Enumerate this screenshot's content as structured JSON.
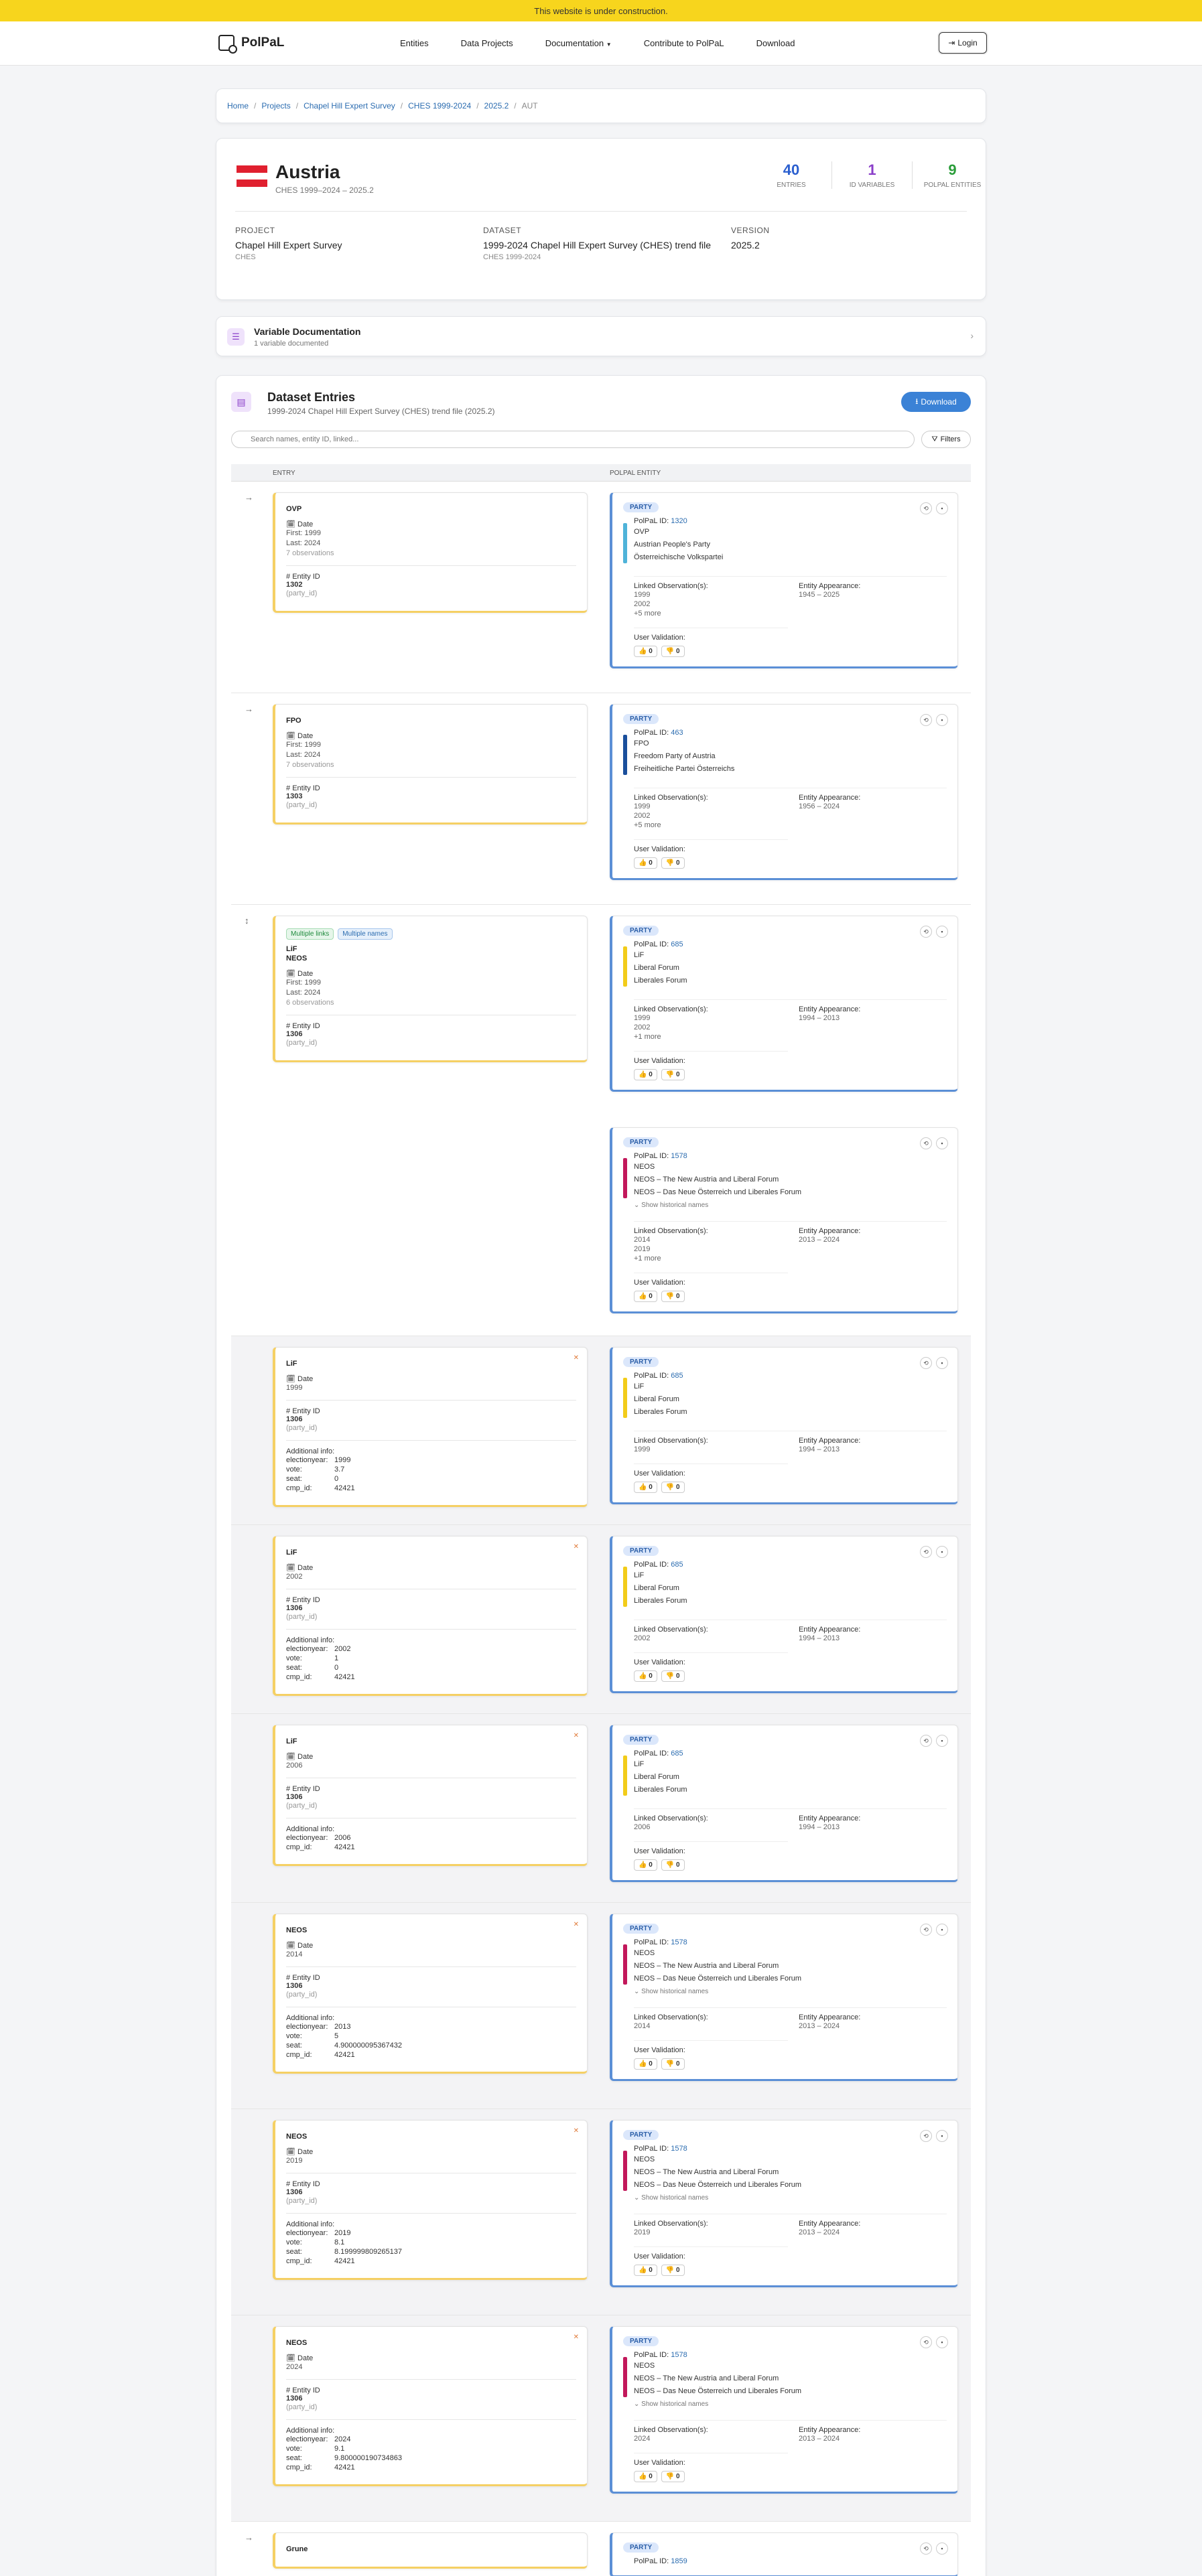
{
  "banner": "This website is under construction.",
  "nav": {
    "brand": "PolPaL",
    "items": [
      "Entities",
      "Data Projects",
      "Documentation",
      "Contribute to PolPaL",
      "Download"
    ],
    "login": "Login"
  },
  "breadcrumb": [
    "Home",
    "Projects",
    "Chapel Hill Expert Survey",
    "CHES 1999-2024",
    "2025.2",
    "AUT"
  ],
  "country": {
    "name": "Austria",
    "range": "CHES 1999–2024 – 2025.2",
    "flag_colors": [
      "#e0202f",
      "#ffffff",
      "#e0202f"
    ],
    "stats": [
      {
        "num": "40",
        "label": "Entries",
        "color": "#2b5fcf"
      },
      {
        "num": "1",
        "label": "ID Variables",
        "color": "#8a3ec9"
      },
      {
        "num": "9",
        "label": "PolPaL Entities",
        "color": "#2a9d3a"
      }
    ],
    "project_label": "Project",
    "project": "Chapel Hill Expert Survey",
    "project_sub": "CHES",
    "dataset_label": "Dataset",
    "dataset": "1999-2024 Chapel Hill Expert Survey (CHES) trend file",
    "dataset_sub": "CHES 1999-2024",
    "version_label": "Version",
    "version": "2025.2"
  },
  "vardoc": {
    "title": "Variable Documentation",
    "sub": "1 variable documented"
  },
  "entries": {
    "title": "Dataset Entries",
    "sub": "1999-2024 Chapel Hill Expert Survey (CHES) trend file (2025.2)",
    "download": "Download",
    "search_placeholder": "Search names, entity ID, linked...",
    "filters": "Filters",
    "col_entry": "Entry",
    "col_entity": "PolPaL Entity"
  },
  "labels": {
    "date": "Date",
    "entity_id": "Entity ID",
    "party_id": "(party_id)",
    "additional": "Additional info:",
    "party": "PARTY",
    "polpal_id": "PolPaL ID:",
    "linked": "Linked Observation(s):",
    "appearance": "Entity Appearance:",
    "validation": "User Validation:",
    "hist": "⌄ Show historical names",
    "zero": "0"
  },
  "rows": [
    {
      "entry": {
        "name": "OVP",
        "first": "First: 1999",
        "last": "Last: 2024",
        "obs": "7 observations",
        "id": "1302"
      },
      "entity": {
        "pid": "1320",
        "lines": [
          "OVP",
          "Austrian People's Party",
          "Österreichische Volkspartei"
        ],
        "color": "#4fb3d9",
        "linked": [
          "1999",
          "2002",
          "+5 more"
        ],
        "appear": "1945 – 2025"
      }
    },
    {
      "entry": {
        "name": "FPO",
        "first": "First: 1999",
        "last": "Last: 2024",
        "obs": "7 observations",
        "id": "1303"
      },
      "entity": {
        "pid": "463",
        "lines": [
          "FPO",
          "Freedom Party of Austria",
          "Freiheitliche Partei Österreichs"
        ],
        "color": "#1a4f9c",
        "linked": [
          "1999",
          "2002",
          "+5 more"
        ],
        "appear": "1956 – 2024"
      }
    },
    {
      "entry": {
        "tags": [
          "Multiple links",
          "Multiple names"
        ],
        "name1": "LiF",
        "name": "NEOS",
        "first": "First: 1999",
        "last": "Last: 2024",
        "obs": "6 observations",
        "id": "1306"
      },
      "entities": [
        {
          "pid": "685",
          "lines": [
            "LiF",
            "Liberal Forum",
            "Liberales Forum"
          ],
          "color": "#f2cc1a",
          "linked": [
            "1999",
            "2002",
            "+1 more"
          ],
          "appear": "1994 – 2013"
        },
        {
          "pid": "1578",
          "lines": [
            "NEOS",
            "NEOS – The New Austria and Liberal Forum",
            "NEOS – Das Neue Österreich und Liberales Forum"
          ],
          "color": "#c2185b",
          "linked": [
            "2014",
            "2019",
            "+1 more"
          ],
          "appear": "2013 – 2024"
        }
      ]
    },
    {
      "entry": {
        "name": "LiF",
        "date": "1999",
        "id": "1306",
        "info": [
          [
            "electionyear:",
            "1999"
          ],
          [
            "vote:",
            "3.7"
          ],
          [
            "seat:",
            "0"
          ],
          [
            "cmp_id:",
            "42421"
          ]
        ]
      },
      "entity": {
        "pid": "685",
        "lines": [
          "LiF",
          "Liberal Forum",
          "Liberales Forum"
        ],
        "color": "#f2cc1a",
        "linked": [
          "1999"
        ],
        "appear": "1994 – 2013"
      }
    },
    {
      "entry": {
        "name": "LiF",
        "date": "2002",
        "id": "1306",
        "info": [
          [
            "electionyear:",
            "2002"
          ],
          [
            "vote:",
            "1"
          ],
          [
            "seat:",
            "0"
          ],
          [
            "cmp_id:",
            "42421"
          ]
        ]
      },
      "entity": {
        "pid": "685",
        "lines": [
          "LiF",
          "Liberal Forum",
          "Liberales Forum"
        ],
        "color": "#f2cc1a",
        "linked": [
          "2002"
        ],
        "appear": "1994 – 2013"
      }
    },
    {
      "entry": {
        "name": "LiF",
        "date": "2006",
        "id": "1306",
        "info": [
          [
            "electionyear:",
            "2006"
          ],
          [
            "cmp_id:",
            "42421"
          ]
        ]
      },
      "entity": {
        "pid": "685",
        "lines": [
          "LiF",
          "Liberal Forum",
          "Liberales Forum"
        ],
        "color": "#f2cc1a",
        "linked": [
          "2006"
        ],
        "appear": "1994 – 2013"
      }
    },
    {
      "entry": {
        "name": "NEOS",
        "date": "2014",
        "id": "1306",
        "info": [
          [
            "electionyear:",
            "2013"
          ],
          [
            "vote:",
            "5"
          ],
          [
            "seat:",
            "4.900000095367432"
          ],
          [
            "cmp_id:",
            "42421"
          ]
        ]
      },
      "entity": {
        "pid": "1578",
        "lines": [
          "NEOS",
          "NEOS – The New Austria and Liberal Forum",
          "NEOS – Das Neue Österreich und Liberales Forum"
        ],
        "color": "#c2185b",
        "linked": [
          "2014"
        ],
        "appear": "2013 – 2024"
      }
    },
    {
      "entry": {
        "name": "NEOS",
        "date": "2019",
        "id": "1306",
        "info": [
          [
            "electionyear:",
            "2019"
          ],
          [
            "vote:",
            "8.1"
          ],
          [
            "seat:",
            "8.199999809265137"
          ],
          [
            "cmp_id:",
            "42421"
          ]
        ]
      },
      "entity": {
        "pid": "1578",
        "lines": [
          "NEOS",
          "NEOS – The New Austria and Liberal Forum",
          "NEOS – Das Neue Österreich und Liberales Forum"
        ],
        "color": "#c2185b",
        "linked": [
          "2019"
        ],
        "appear": "2013 – 2024"
      }
    },
    {
      "entry": {
        "name": "NEOS",
        "date": "2024",
        "id": "1306",
        "info": [
          [
            "electionyear:",
            "2024"
          ],
          [
            "vote:",
            "9.1"
          ],
          [
            "seat:",
            "9.800000190734863"
          ],
          [
            "cmp_id:",
            "42421"
          ]
        ]
      },
      "entity": {
        "pid": "1578",
        "lines": [
          "NEOS",
          "NEOS – The New Austria and Liberal Forum",
          "NEOS – Das Neue Österreich und Liberales Forum"
        ],
        "color": "#c2185b",
        "linked": [
          "2024"
        ],
        "appear": "2013 – 2024"
      }
    },
    {
      "entry": {
        "name": "Grune"
      },
      "entity": {
        "pid": "1859"
      }
    }
  ]
}
